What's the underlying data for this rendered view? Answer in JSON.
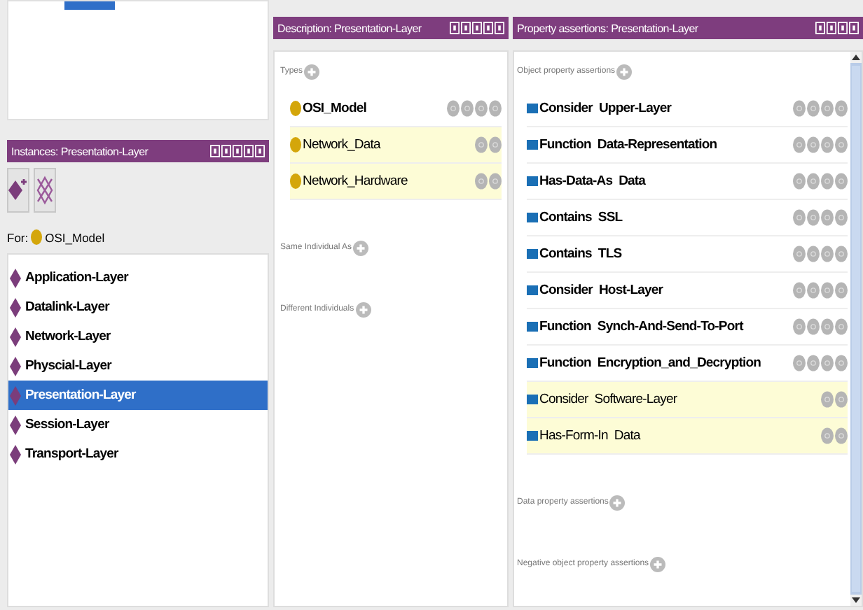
{
  "class_tree": {
    "selected_row_visible": true
  },
  "instances": {
    "title": "Instances: Presentation-Layer",
    "for_label": "For:",
    "for_class": "OSI_Model",
    "items": [
      {
        "label": "Application-Layer",
        "selected": false
      },
      {
        "label": "Datalink-Layer",
        "selected": false
      },
      {
        "label": "Network-Layer",
        "selected": false
      },
      {
        "label": "Physcial-Layer",
        "selected": false
      },
      {
        "label": "Presentation-Layer",
        "selected": true
      },
      {
        "label": "Session-Layer",
        "selected": false
      },
      {
        "label": "Transport-Layer",
        "selected": false
      }
    ]
  },
  "description": {
    "title": "Description: Presentation-Layer",
    "types_label": "Types",
    "types": [
      {
        "label": "OSI_Model",
        "inferred": false
      },
      {
        "label": "Network_Data",
        "inferred": true
      },
      {
        "label": "Network_Hardware",
        "inferred": true
      }
    ],
    "sections": [
      "Same Individual As",
      "Different Individuals"
    ]
  },
  "property_assertions": {
    "title": "Property assertions: Presentation-Layer",
    "object_label": "Object property assertions",
    "object_assertions": [
      {
        "property": "Consider",
        "value": "Upper-Layer",
        "inferred": false
      },
      {
        "property": "Function",
        "value": "Data-Representation",
        "inferred": false
      },
      {
        "property": "Has-Data-As",
        "value": "Data",
        "inferred": false
      },
      {
        "property": "Contains",
        "value": "SSL",
        "inferred": false
      },
      {
        "property": "Contains",
        "value": "TLS",
        "inferred": false
      },
      {
        "property": "Consider",
        "value": "Host-Layer",
        "inferred": false
      },
      {
        "property": "Function",
        "value": "Synch-And-Send-To-Port",
        "inferred": false
      },
      {
        "property": "Function",
        "value": "Encryption_and_Decryption",
        "inferred": false
      },
      {
        "property": "Consider",
        "value": "Software-Layer",
        "inferred": true
      },
      {
        "property": "Has-Form-In",
        "value": "Data",
        "inferred": true
      }
    ],
    "sections": [
      "Data property assertions",
      "Negative object property assertions"
    ]
  }
}
